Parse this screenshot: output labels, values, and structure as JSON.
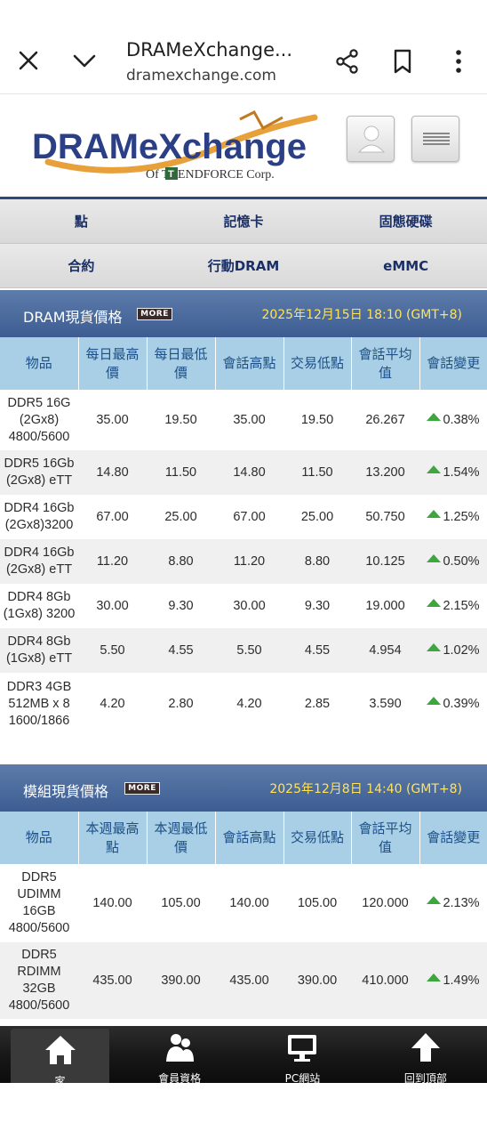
{
  "browser": {
    "title": "DRAMeXchange...",
    "url": "dramexchange.com",
    "icons": [
      "close-icon",
      "chevron-down-icon",
      "share-icon",
      "bookmark-icon",
      "more-vert-icon"
    ]
  },
  "header": {
    "logo_main": "DRAMeXchange",
    "logo_sub": "Of  TRENDFORCE Corp.",
    "icons": [
      "user-icon",
      "menu-icon"
    ]
  },
  "nav": {
    "row1": [
      "點",
      "記憶卡",
      "固態硬碟"
    ],
    "row2": [
      "合約",
      "行動DRAM",
      "eMMC"
    ]
  },
  "dram": {
    "title": "DRAM現貨價格",
    "more": "MORE",
    "date": "2025年12月15日 18:10 (GMT+8)",
    "headers": [
      "物品",
      "每日最高價",
      "每日最低價",
      "會話高點",
      "交易低點",
      "會話平均值",
      "會話變更"
    ],
    "rows": [
      {
        "item": "DDR5 16G (2Gx8) 4800/5600",
        "hi": "35.00",
        "lo": "19.50",
        "sh": "35.00",
        "tl": "19.50",
        "avg": "26.267",
        "chg": "0.38%"
      },
      {
        "item": "DDR5 16Gb (2Gx8) eTT",
        "hi": "14.80",
        "lo": "11.50",
        "sh": "14.80",
        "tl": "11.50",
        "avg": "13.200",
        "chg": "1.54%"
      },
      {
        "item": "DDR4 16Gb (2Gx8)3200",
        "hi": "67.00",
        "lo": "25.00",
        "sh": "67.00",
        "tl": "25.00",
        "avg": "50.750",
        "chg": "1.25%"
      },
      {
        "item": "DDR4 16Gb (2Gx8) eTT",
        "hi": "11.20",
        "lo": "8.80",
        "sh": "11.20",
        "tl": "8.80",
        "avg": "10.125",
        "chg": "0.50%"
      },
      {
        "item": "DDR4 8Gb (1Gx8) 3200",
        "hi": "30.00",
        "lo": "9.30",
        "sh": "30.00",
        "tl": "9.30",
        "avg": "19.000",
        "chg": "2.15%"
      },
      {
        "item": "DDR4 8Gb (1Gx8) eTT",
        "hi": "5.50",
        "lo": "4.55",
        "sh": "5.50",
        "tl": "4.55",
        "avg": "4.954",
        "chg": "1.02%"
      },
      {
        "item": "DDR3 4GB 512MB x 8 1600/1866",
        "hi": "4.20",
        "lo": "2.80",
        "sh": "4.20",
        "tl": "2.85",
        "avg": "3.590",
        "chg": "0.39%"
      }
    ]
  },
  "module": {
    "title": "模組現貨價格",
    "more": "MORE",
    "date": "2025年12月8日 14:40 (GMT+8)",
    "headers": [
      "物品",
      "本週最高點",
      "本週最低價",
      "會話高點",
      "交易低點",
      "會話平均值",
      "會話變更"
    ],
    "rows": [
      {
        "item": "DDR5 UDIMM 16GB 4800/5600",
        "hi": "140.00",
        "lo": "105.00",
        "sh": "140.00",
        "tl": "105.00",
        "avg": "120.000",
        "chg": "2.13%"
      },
      {
        "item": "DDR5 RDIMM 32GB 4800/5600",
        "hi": "435.00",
        "lo": "390.00",
        "sh": "435.00",
        "tl": "390.00",
        "avg": "410.000",
        "chg": "1.49%"
      }
    ]
  },
  "bottom_nav": [
    {
      "label": "家",
      "icon": "home-icon",
      "active": true
    },
    {
      "label": "會員資格",
      "icon": "members-icon",
      "active": false
    },
    {
      "label": "PC網站",
      "icon": "monitor-icon",
      "active": false
    },
    {
      "label": "回到頂部",
      "icon": "arrow-up-icon",
      "active": false
    }
  ],
  "colors": {
    "nav_text": "#1a2f66",
    "section_header": "#4a6a9e",
    "date_text": "#ffe35a",
    "table_header_bg": "#a8cfe6",
    "up_arrow": "#3fa53f"
  }
}
